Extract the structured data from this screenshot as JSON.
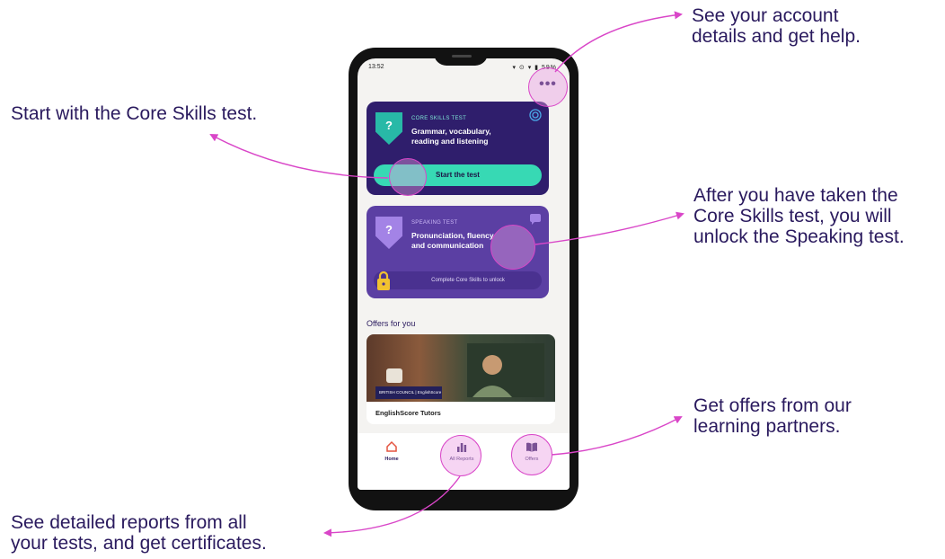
{
  "callouts": {
    "account": [
      "See your account",
      "details and get help."
    ],
    "core": [
      "Start with the Core Skills test."
    ],
    "speaking": [
      "After you have taken the",
      "Core Skills test, you will",
      "unlock the Speaking test."
    ],
    "offers": [
      "Get offers from our",
      "learning partners."
    ],
    "reports": [
      "See detailed reports from all",
      "your tests, and get certificates."
    ]
  },
  "status_bar": {
    "time": "13:52",
    "icons": "▾ ⊙ ▾ ▮ 59%"
  },
  "menu_icon": "more-dots-icon",
  "core_card": {
    "label": "CORE SKILLS TEST",
    "title_line1": "Grammar, vocabulary,",
    "title_line2": "reading and listening",
    "button": "Start the test",
    "shield_symbol": "?"
  },
  "speaking_card": {
    "label": "SPEAKING TEST",
    "title_line1": "Pronunciation, fluency",
    "title_line2": "and communication",
    "lock_text": "Complete Core Skills to unlock",
    "shield_symbol": "?"
  },
  "offers": {
    "section_title": "Offers for you",
    "card_name": "EnglishScore Tutors",
    "logo_text": "BRITISH COUNCIL | EnglishScore Tutors"
  },
  "nav": {
    "home": "Home",
    "reports": "All Reports",
    "offers": "Offers"
  },
  "colors": {
    "accent": "#d946c8",
    "text": "#2a1a5e",
    "core_card": "#2f1e6c",
    "speaking_card": "#5b3fa3",
    "teal": "#37d9b4"
  }
}
